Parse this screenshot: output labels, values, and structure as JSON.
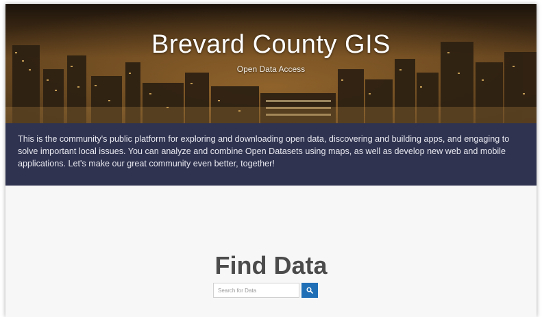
{
  "hero": {
    "title": "Brevard County GIS",
    "subtitle": "Open Data Access"
  },
  "intro": {
    "text": "This is the community's public platform for exploring and downloading open data, discovering and building apps, and engaging to solve important local issues. You can analyze and combine Open Datasets using maps, as well as develop new web and mobile applications. Let's make our great community even better, together!"
  },
  "find": {
    "title": "Find Data",
    "search_placeholder": "Search for Data",
    "search_icon": "search-icon"
  },
  "colors": {
    "band": "#2f3350",
    "search_button": "#1f6fb6",
    "page_background": "#f7f7f7"
  }
}
